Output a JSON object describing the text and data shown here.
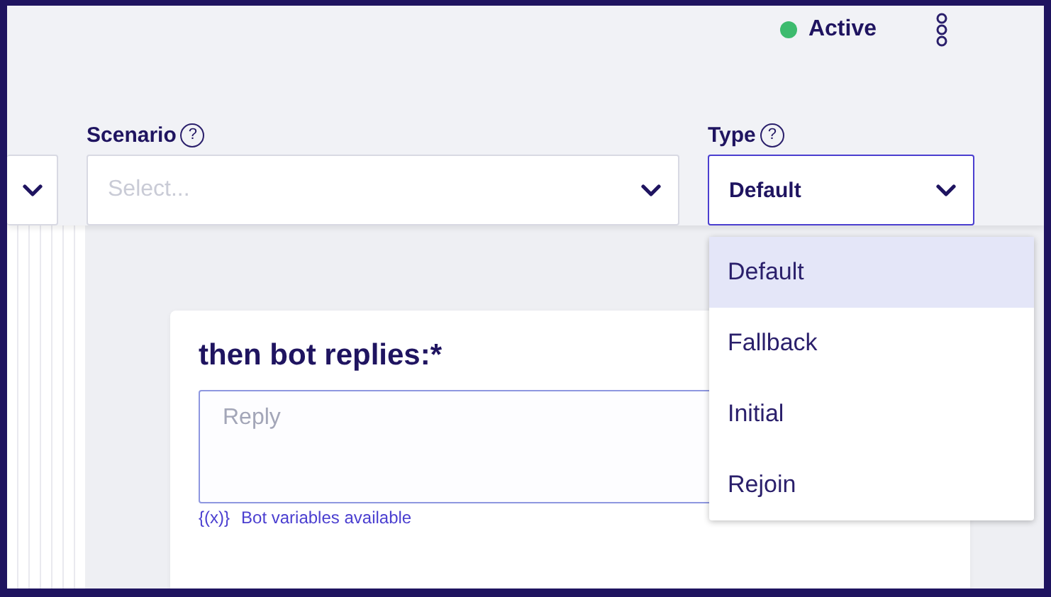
{
  "status": {
    "label": "Active",
    "color": "#3dbb6e"
  },
  "filters": [
    {
      "focused": false
    },
    {
      "label": "Scenario",
      "help": "?",
      "placeholder": "Select...",
      "focused": false
    },
    {
      "label": "Type",
      "help": "?",
      "value": "Default",
      "focused": true
    }
  ],
  "type_menu": [
    {
      "label": "Default",
      "selected": true
    },
    {
      "label": "Fallback",
      "selected": false
    },
    {
      "label": "Initial",
      "selected": false
    },
    {
      "label": "Rejoin",
      "selected": false
    }
  ],
  "card": {
    "title": "then bot replies:*",
    "reply_placeholder": "Reply",
    "variables_icon": "{(x)}",
    "variables_link": "Bot variables available"
  }
}
